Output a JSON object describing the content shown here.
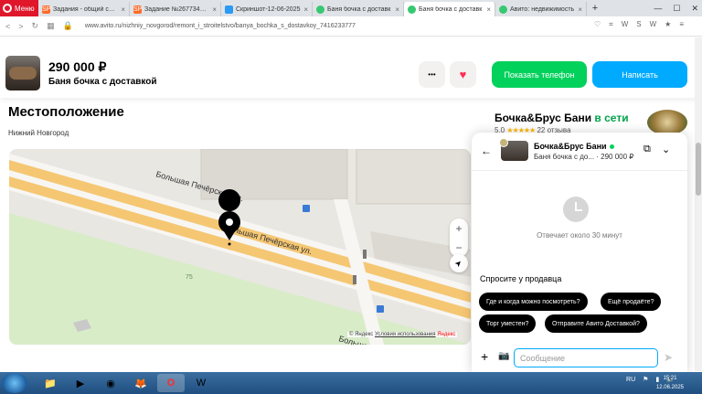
{
  "browser": {
    "menu_label": "Меню",
    "tabs": [
      {
        "label": "Задания - общий спис",
        "icon_text": "SP",
        "color": "#ff6a2a",
        "active": false
      },
      {
        "label": "Задание №2677347 - о",
        "icon_text": "SP",
        "color": "#ff6a2a",
        "active": false
      },
      {
        "label": "Скриншот-12-06-2025",
        "icon_text": "",
        "color": "#2a9af5",
        "active": false
      },
      {
        "label": "Баня бочка с доставк",
        "icon_text": "",
        "color": "#37c871",
        "active": false
      },
      {
        "label": "Баня бочка с доставк",
        "icon_text": "",
        "color": "#37c871",
        "active": true
      },
      {
        "label": "Авито: недвижимость",
        "icon_text": "",
        "color": "#37c871",
        "active": false
      }
    ],
    "new_tab": "+",
    "url": "www.avito.ru/nizhniy_novgorod/remont_i_stroitelstvo/banya_bochka_s_dostavkoy_7416233777",
    "ext_icons": [
      "W",
      "S",
      "W",
      "★",
      "≡"
    ]
  },
  "header": {
    "price": "290 000 ₽",
    "title": "Баня бочка с доставкой",
    "more_label": "•••",
    "favorite_label": "♥",
    "show_phone": "Показать телефон",
    "write": "Написать"
  },
  "location": {
    "title": "Местоположение",
    "city": "Нижний Новгород",
    "street_1": "Большая Печёрская ул.",
    "street_2": "Большая Печёрская ул.",
    "street_3": "Большая Печёрская ул.",
    "house_number": "75",
    "copyright": "© Яндекс",
    "terms": "Условия использования",
    "yandex": "Яндекс",
    "zoom_in": "+",
    "zoom_out": "−",
    "locate": "➤"
  },
  "seller": {
    "name": "Бочка&Брус Бани",
    "online": "в сети",
    "rating": "5,0",
    "stars": "★★★★★",
    "reviews": "22 отзыва"
  },
  "chat": {
    "back": "←",
    "seller": "Бочка&Брус Бани",
    "item": "Баня бочка с до... · 290 000 ₽",
    "open": "⧉",
    "collapse": "⌄",
    "response_time": "Отвечает около 30 минут",
    "ask_title": "Спросите у продавца",
    "chips": [
      "Где и когда можно посмотреть?",
      "Ещё продаёте?",
      "Торг уместен?",
      "Отправите Авито Доставкой?"
    ],
    "plus": "+",
    "camera": "📷",
    "input_placeholder": "Сообщение",
    "send": "➤"
  },
  "taskbar": {
    "lang": "RU",
    "time": "15:21",
    "date": "12.06.2025"
  }
}
